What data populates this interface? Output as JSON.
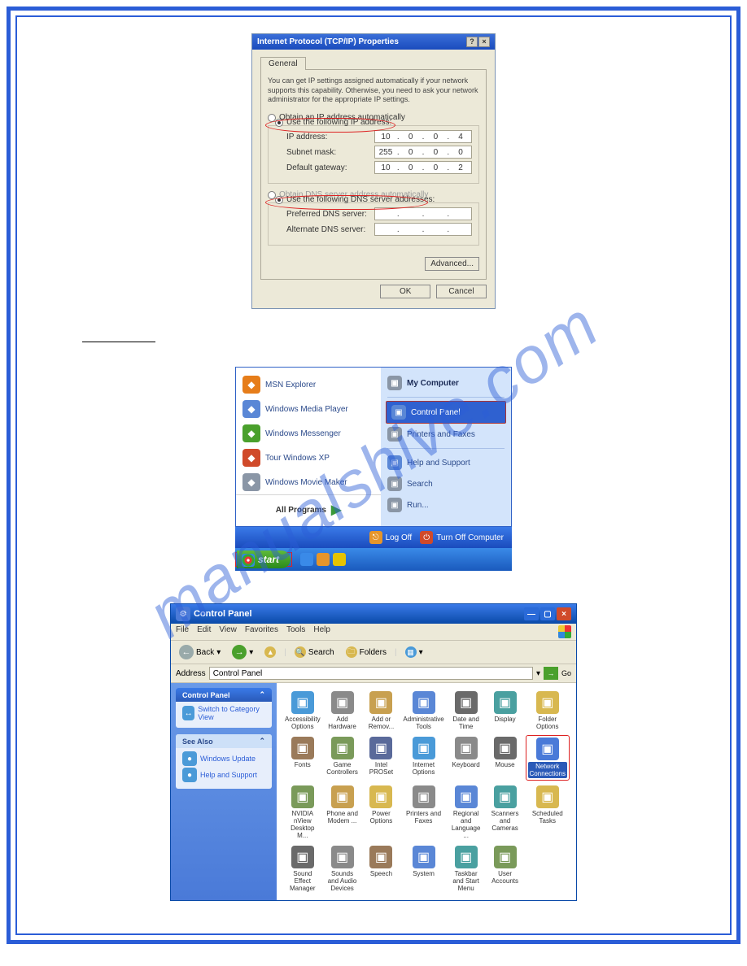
{
  "watermark": "manualshive.com",
  "dlg1": {
    "title": "Internet Protocol (TCP/IP) Properties",
    "tab": "General",
    "description": "You can get IP settings assigned automatically if your network supports this capability. Otherwise, you need to ask your network administrator for the appropriate IP settings.",
    "radio_auto_ip": "Obtain an IP address automatically",
    "radio_manual_ip": "Use the following IP address:",
    "lbl_ip": "IP address:",
    "val_ip": [
      "10",
      "0",
      "0",
      "4"
    ],
    "lbl_mask": "Subnet mask:",
    "val_mask": [
      "255",
      "0",
      "0",
      "0"
    ],
    "lbl_gateway": "Default gateway:",
    "val_gateway": [
      "10",
      "0",
      "0",
      "2"
    ],
    "radio_auto_dns": "Obtain DNS server address automatically",
    "radio_manual_dns": "Use the following DNS server addresses:",
    "lbl_pref_dns": "Preferred DNS server:",
    "lbl_alt_dns": "Alternate DNS server:",
    "btn_advanced": "Advanced...",
    "btn_ok": "OK",
    "btn_cancel": "Cancel"
  },
  "startmenu": {
    "left": [
      {
        "label": "MSN Explorer",
        "icon": "orange"
      },
      {
        "label": "Windows Media Player",
        "icon": "blue"
      },
      {
        "label": "Windows Messenger",
        "icon": "green"
      },
      {
        "label": "Tour Windows XP",
        "icon": "red"
      },
      {
        "label": "Windows Movie Maker",
        "icon": "grey"
      }
    ],
    "all_programs": "All Programs",
    "right": [
      {
        "label": "My Computer",
        "bold": true,
        "icon": "grey"
      },
      {
        "label": "Control Panel",
        "selected": true,
        "icon": "blue"
      },
      {
        "label": "Printers and Faxes",
        "icon": "grey"
      },
      {
        "label": "Help and Support",
        "icon": "blue"
      },
      {
        "label": "Search",
        "icon": "grey"
      },
      {
        "label": "Run...",
        "icon": "grey"
      }
    ],
    "logoff": "Log Off",
    "turnoff": "Turn Off Computer",
    "start": "start"
  },
  "cp": {
    "title": "Control Panel",
    "menu": [
      "File",
      "Edit",
      "View",
      "Favorites",
      "Tools",
      "Help"
    ],
    "tb_back": "Back",
    "tb_search": "Search",
    "tb_folders": "Folders",
    "addr_label": "Address",
    "addr_value": "Control Panel",
    "go": "Go",
    "side1_title": "Control Panel",
    "side1_link": "Switch to Category View",
    "side2_title": "See Also",
    "side2_links": [
      "Windows Update",
      "Help and Support"
    ],
    "icons": [
      {
        "label": "Accessibility Options",
        "c": "c1"
      },
      {
        "label": "Add Hardware",
        "c": "c2"
      },
      {
        "label": "Add or Remov...",
        "c": "c3"
      },
      {
        "label": "Administrative Tools",
        "c": "c4"
      },
      {
        "label": "Date and Time",
        "c": "c5"
      },
      {
        "label": "Display",
        "c": "c6"
      },
      {
        "label": "Folder Options",
        "c": "c7"
      },
      {
        "label": "Fonts",
        "c": "c8"
      },
      {
        "label": "Game Controllers",
        "c": "c9"
      },
      {
        "label": "Intel PROSet",
        "c": "c10"
      },
      {
        "label": "Internet Options",
        "c": "c1"
      },
      {
        "label": "Keyboard",
        "c": "c2"
      },
      {
        "label": "Mouse",
        "c": "c5"
      },
      {
        "label": "Network Connections",
        "c": "c11",
        "sel": true
      },
      {
        "label": "NVIDIA nView Desktop M...",
        "c": "c9"
      },
      {
        "label": "Phone and Modem ...",
        "c": "c3"
      },
      {
        "label": "Power Options",
        "c": "c7"
      },
      {
        "label": "Printers and Faxes",
        "c": "c2"
      },
      {
        "label": "Regional and Language ...",
        "c": "c4"
      },
      {
        "label": "Scanners and Cameras",
        "c": "c6"
      },
      {
        "label": "Scheduled Tasks",
        "c": "c7"
      },
      {
        "label": "Sound Effect Manager",
        "c": "c5"
      },
      {
        "label": "Sounds and Audio Devices",
        "c": "c2"
      },
      {
        "label": "Speech",
        "c": "c8"
      },
      {
        "label": "System",
        "c": "c4"
      },
      {
        "label": "Taskbar and Start Menu",
        "c": "c6"
      },
      {
        "label": "User Accounts",
        "c": "c9"
      }
    ]
  }
}
